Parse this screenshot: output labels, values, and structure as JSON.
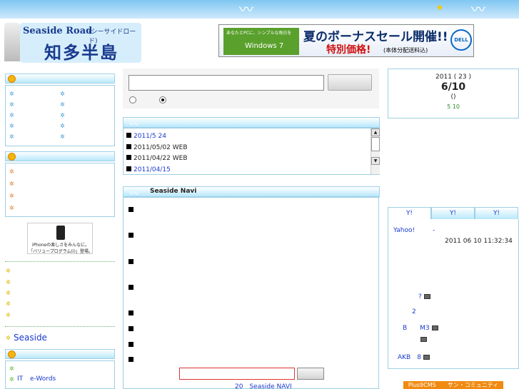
{
  "header": {
    "logo_title_en": "Seaside Road",
    "logo_title_kana": "(シーサイドロード)",
    "logo_title_jp": "知多半島"
  },
  "ad_banner": {
    "tagline": "あなたとPCに、シンプルな毎日を",
    "os": "Windows 7",
    "headline": "夏のボーナスセール開催!!",
    "price": "特別価格!",
    "note": "(本体分配送料込)",
    "brand": "DELL"
  },
  "news": {
    "items": [
      {
        "date": "2011/5 24",
        "text": "",
        "link": true
      },
      {
        "date": "2011/05/02",
        "text": "WEB",
        "link": false
      },
      {
        "date": "2011/04/22",
        "text": "WEB",
        "link": false
      },
      {
        "date": "2011/04/15",
        "text": "",
        "link": true
      }
    ]
  },
  "navi": {
    "title": "Seaside Navi",
    "footer": "20　Seaside NAVI"
  },
  "date_panel": {
    "year_line": "2011 ( 23 )",
    "date": "6/10",
    "weekday": "()",
    "sub": "5 10"
  },
  "tabs": [
    "Y!",
    "Y!",
    "Y!"
  ],
  "yahoo": {
    "source": "Yahoo!",
    "dash": "-",
    "timestamp": "2011 06 10 11:32:34",
    "items": [
      "?",
      "2",
      "B　　M3",
      "",
      "AKB　8"
    ]
  },
  "sidebar": {
    "seaside_link": "Seaside",
    "it_link_1": "IT",
    "it_link_2": "e-Words",
    "iphone_line1": "iPhoneの楽しさをみんなに。",
    "iphone_line2": "「バリュープログラム(i)」登場。"
  },
  "plus": {
    "label": "Plus9CMS　　サン・コミュニティ"
  }
}
